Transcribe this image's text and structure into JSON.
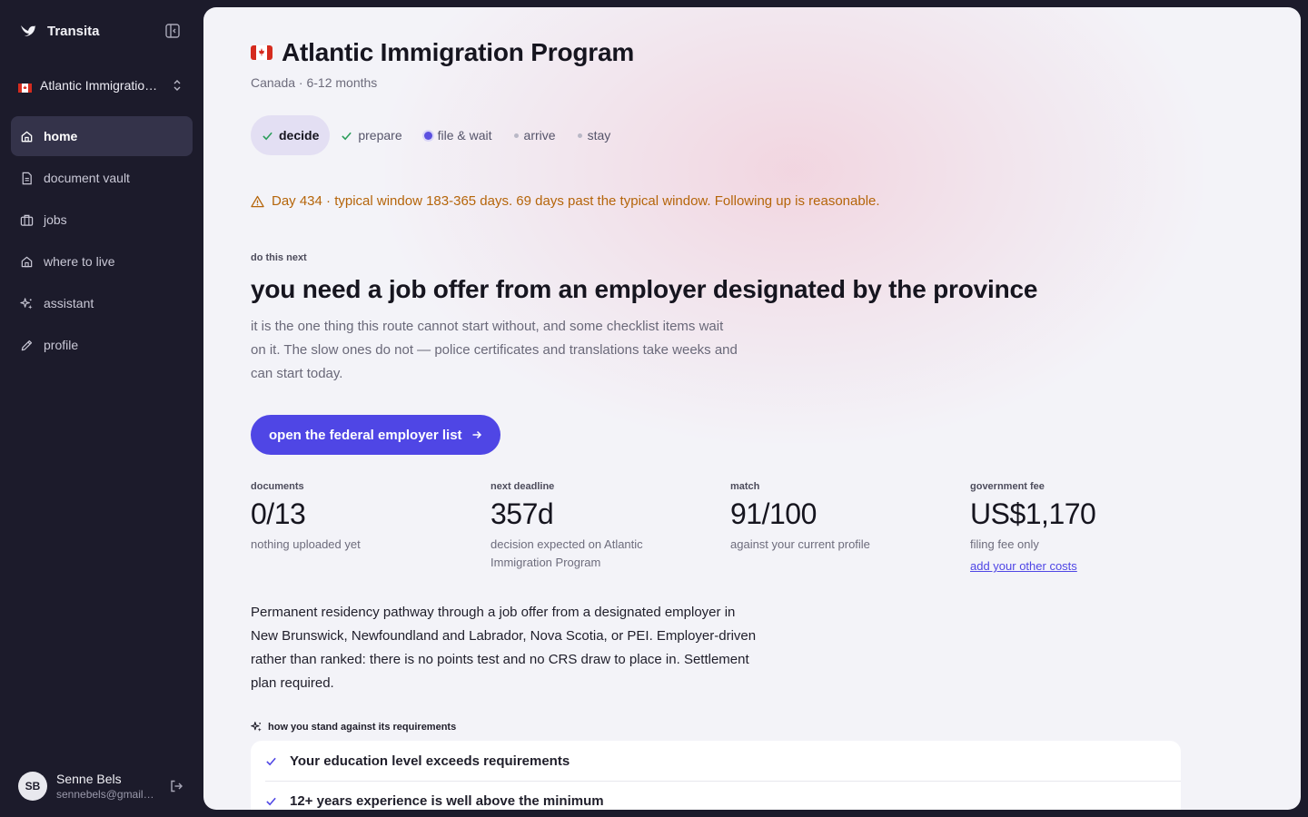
{
  "app": {
    "name": "Transita"
  },
  "sidebar": {
    "program_switch": {
      "label": "Atlantic Immigration Program"
    },
    "items": [
      {
        "label": "home",
        "icon": "home-icon",
        "active": true
      },
      {
        "label": "document vault",
        "icon": "document-icon",
        "active": false
      },
      {
        "label": "jobs",
        "icon": "briefcase-icon",
        "active": false
      },
      {
        "label": "where to live",
        "icon": "house-icon",
        "active": false
      },
      {
        "label": "assistant",
        "icon": "sparkle-icon",
        "active": false
      },
      {
        "label": "profile",
        "icon": "pencil-icon",
        "active": false
      }
    ],
    "user": {
      "initials": "SB",
      "name": "Senne Bels",
      "email": "sennebels@gmail.com"
    }
  },
  "page": {
    "title": "Atlantic Immigration Program",
    "subtitle": "Canada · 6-12 months",
    "stepper": [
      {
        "label": "decide",
        "state": "done-current"
      },
      {
        "label": "prepare",
        "state": "done"
      },
      {
        "label": "file & wait",
        "state": "live"
      },
      {
        "label": "arrive",
        "state": "upcoming"
      },
      {
        "label": "stay",
        "state": "upcoming"
      }
    ],
    "warning": "Day 434 · typical window 183-365 days. 69 days past the typical window. Following up is reasonable.",
    "next": {
      "eyebrow": "do this next",
      "headline": "you need a job offer from an employer designated by the province",
      "lead": "it is the one thing this route cannot start without, and some checklist items wait on it. The slow ones do not — police certificates and translations take weeks and can start today.",
      "cta": "open the federal employer list"
    },
    "stats": [
      {
        "label": "documents",
        "value": "0/13",
        "note": "nothing uploaded yet"
      },
      {
        "label": "next deadline",
        "value": "357d",
        "note": "decision expected on Atlantic Immigration Program"
      },
      {
        "label": "match",
        "value": "91/100",
        "note": "against your current profile"
      },
      {
        "label": "government fee",
        "value": "US$1,170",
        "note": "filing fee only",
        "link": "add your other costs"
      }
    ],
    "description": "Permanent residency pathway through a job offer from a designated employer in New Brunswick, Newfoundland and Labrador, Nova Scotia, or PEI. Employer-driven rather than ranked: there is no points test and no CRS draw to place in. Settlement plan required.",
    "requirements": {
      "heading": "how you stand against its requirements",
      "items": [
        "Your education level exceeds requirements",
        "12+ years experience is well above the minimum"
      ]
    }
  },
  "colors": {
    "accent": "#4f46e5",
    "warning": "#b5650a",
    "sidebar_bg": "#1c1b2b",
    "flag_red": "#d52b1e"
  }
}
